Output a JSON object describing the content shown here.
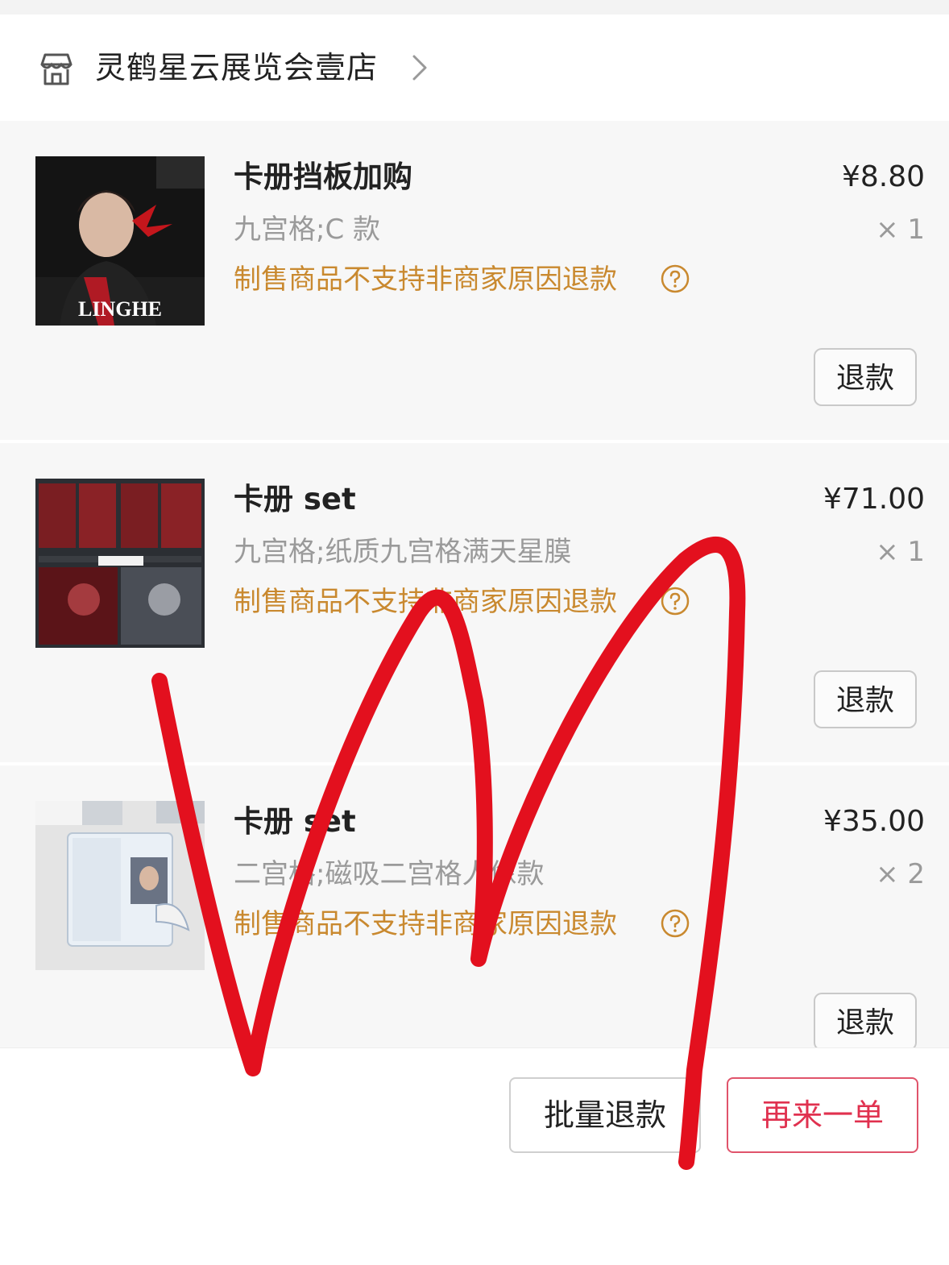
{
  "shop": {
    "name": "灵鹤星云展览会壹店"
  },
  "items": [
    {
      "title": "卡册挡板加购",
      "spec": "九宫格;C 款",
      "notice": "制售商品不支持非商家原因退款",
      "price": "¥8.80",
      "qty": "× 1",
      "refund_label": "退款",
      "thumb_text": "LINGHE"
    },
    {
      "title": "卡册 set",
      "spec": "九宫格;纸质九宫格满天星膜",
      "notice": "制售商品不支持非商家原因退款",
      "price": "¥71.00",
      "qty": "× 1",
      "refund_label": "退款"
    },
    {
      "title": "卡册 set",
      "spec": "二宫格;磁吸二宫格人像款",
      "notice": "制售商品不支持非商家原因退款",
      "price": "¥35.00",
      "qty": "× 2",
      "refund_label": "退款"
    }
  ],
  "footer": {
    "batch_refund_label": "批量退款",
    "reorder_label": "再来一单"
  },
  "colors": {
    "notice": "#c9892f",
    "accent": "#e0314f",
    "scribble": "#e3101e",
    "background": "#f7f7f7"
  },
  "icons": {
    "shop": "store-icon",
    "chevron": "chevron-right-icon",
    "help": "help-circle-icon"
  }
}
